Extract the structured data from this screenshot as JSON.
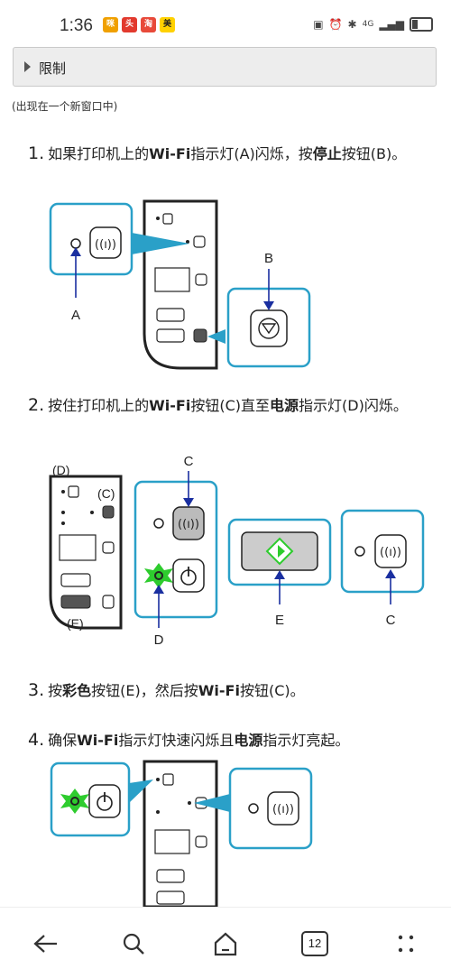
{
  "status": {
    "time": "1:36",
    "app_icons": [
      "tv-app-icon",
      "news-app-icon",
      "shop-app-icon",
      "meituan-app-icon"
    ],
    "app_icon_labels": [
      "咪咕",
      "头条",
      "淘",
      "美"
    ],
    "network_label": "4G"
  },
  "restrict": {
    "label": "限制"
  },
  "note": "(出现在一个新窗口中)",
  "steps": [
    {
      "num": "1.",
      "parts": [
        "如果打印机上的",
        "Wi-Fi",
        "指示灯(A)闪烁，按",
        "停止",
        "按钮(B)。"
      ]
    },
    {
      "num": "2.",
      "parts": [
        "按住打印机上的",
        "Wi-Fi",
        "按钮(C)直至",
        "电源",
        "指示灯(D)闪烁。"
      ]
    },
    {
      "num": "3.",
      "parts": [
        "按",
        "彩色",
        "按钮(E)，然后按",
        "Wi-Fi",
        "按钮(C)。"
      ]
    },
    {
      "num": "4.",
      "parts": [
        "确保",
        "Wi-Fi",
        "指示灯快速闪烁且",
        "电源",
        "指示灯亮起。"
      ]
    }
  ],
  "fig1": {
    "label_a": "A",
    "label_b": "B"
  },
  "fig2": {
    "label_d_top": "(D)",
    "label_c_top": "(C)",
    "label_e_bottom": "(E)",
    "label_c": "C",
    "label_d": "D",
    "label_e": "E",
    "label_c2": "C"
  },
  "nav": {
    "tab_count": "12"
  },
  "colors": {
    "accent_blue": "#2aa0c8",
    "arrow_blue": "#1a2fa0",
    "wifi_green": "#2ecc2e"
  }
}
